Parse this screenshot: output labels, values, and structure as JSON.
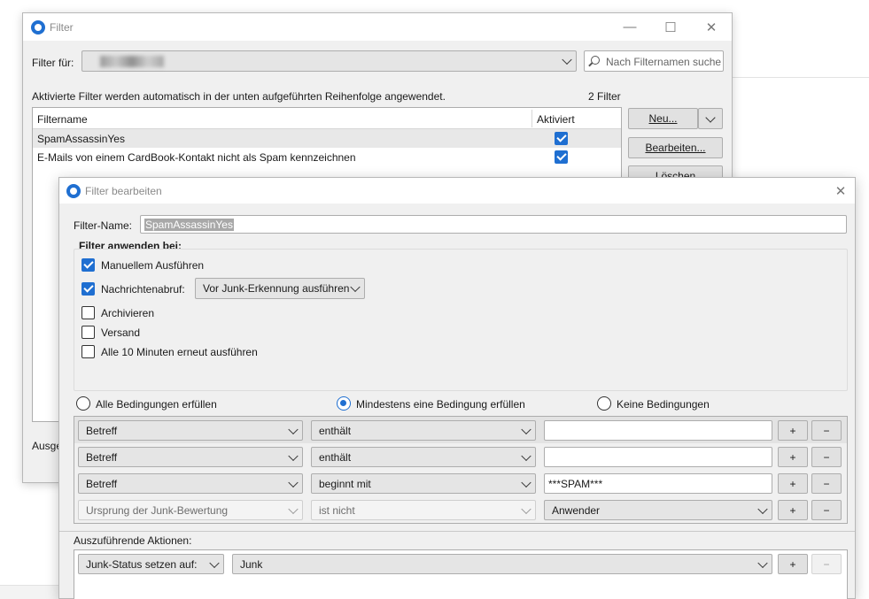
{
  "back_window": {
    "title": "Filter",
    "filter_for_label": "Filter für:",
    "search_placeholder": "Nach Filternamen suche",
    "info_text": "Aktivierte Filter werden automatisch in der unten aufgeführten Reihenfolge angewendet.",
    "filter_count": "2 Filter",
    "columns": {
      "name": "Filtername",
      "enabled": "Aktiviert"
    },
    "filters": [
      {
        "name": "SpamAssassinYes",
        "enabled": true
      },
      {
        "name": "E-Mails von einem CardBook-Kontakt nicht als Spam kennzeichnen",
        "enabled": true
      }
    ],
    "buttons": {
      "new": "Neu...",
      "edit": "Bearbeiten...",
      "delete": "Löschen"
    },
    "bottom_label_partial": "Ausge"
  },
  "edit_window": {
    "title": "Filter bearbeiten",
    "filter_name_label": "Filter-Name:",
    "filter_name_value": "SpamAssassinYes",
    "apply_when_label": "Filter anwenden bei:",
    "apply_options": [
      {
        "label": "Manuellem Ausführen",
        "checked": true
      },
      {
        "label": "Nachrichtenabruf:",
        "checked": true
      },
      {
        "label": "Archivieren",
        "checked": false
      },
      {
        "label": "Versand",
        "checked": false
      },
      {
        "label": "Alle 10 Minuten erneut ausführen",
        "checked": false
      }
    ],
    "fetch_timing": "Vor Junk-Erkennung ausführen",
    "match_modes": [
      {
        "label": "Alle Bedingungen erfüllen",
        "selected": false
      },
      {
        "label": "Mindestens eine Bedingung erfüllen",
        "selected": true
      },
      {
        "label": "Keine Bedingungen",
        "selected": false
      }
    ],
    "rules": [
      {
        "field": "Betreff",
        "operator": "enthält",
        "value": "",
        "disabled": false
      },
      {
        "field": "Betreff",
        "operator": "enthält",
        "value": "",
        "disabled": false
      },
      {
        "field": "Betreff",
        "operator": "beginnt mit",
        "value": "***SPAM***",
        "disabled": false
      },
      {
        "field": "Ursprung der Junk-Bewertung",
        "operator": "ist nicht",
        "value": "Anwender",
        "disabled": true
      }
    ],
    "plus": "+",
    "minus": "−",
    "actions_label": "Auszuführende Aktionen:",
    "action": {
      "type": "Junk-Status setzen auf:",
      "value": "Junk"
    }
  }
}
